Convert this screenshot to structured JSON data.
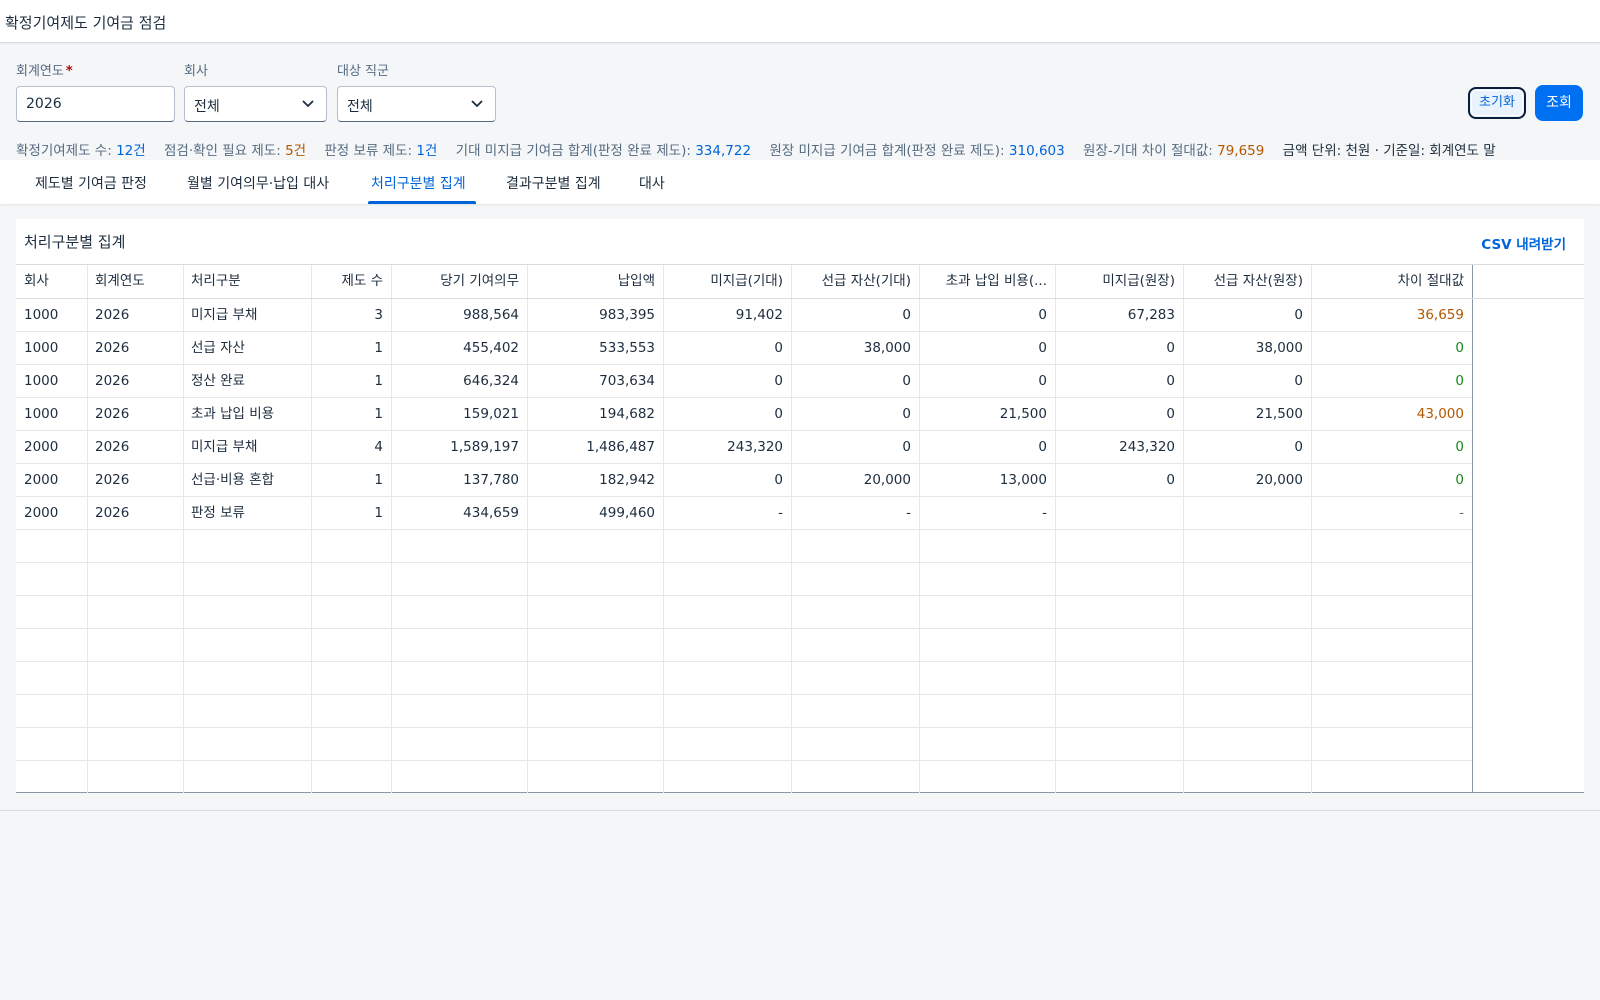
{
  "header": {
    "title": "확정기여제도 기여금 점검"
  },
  "filters": {
    "year": {
      "label": "회계연도",
      "required_mark": "*",
      "value": "2026"
    },
    "company": {
      "label": "회사",
      "value": "전체"
    },
    "group": {
      "label": "대상 직군",
      "value": "전체"
    }
  },
  "buttons": {
    "reset": "초기화",
    "search": "조회"
  },
  "kpis": [
    {
      "label": "확정기여제도 수:",
      "value": "12건",
      "tone": "info"
    },
    {
      "label": "점검·확인 필요 제도:",
      "value": "5건",
      "tone": "warn"
    },
    {
      "label": "판정 보류 제도:",
      "value": "1건",
      "tone": "info"
    },
    {
      "label": "기대 미지급 기여금 합계(판정 완료 제도):",
      "value": "334,722",
      "tone": "info"
    },
    {
      "label": "원장 미지급 기여금 합계(판정 완료 제도):",
      "value": "310,603",
      "tone": "info"
    },
    {
      "label": "원장-기대 차이 절대값:",
      "value": "79,659",
      "tone": "warn"
    }
  ],
  "unit_note": "금액 단위: 천원 · 기준일: 회계연도 말",
  "tabs": [
    {
      "label": "제도별 기여금 판정"
    },
    {
      "label": "월별 기여의무·납입 대사"
    },
    {
      "label": "처리구분별 집계",
      "active": true
    },
    {
      "label": "결과구분별 집계"
    },
    {
      "label": "대사"
    }
  ],
  "panel": {
    "title": "처리구분별 집계",
    "csv_label": "CSV 내려받기"
  },
  "table": {
    "columns": [
      "회사",
      "회계연도",
      "처리구분",
      "제도 수",
      "당기 기여의무",
      "납입액",
      "미지급(기대)",
      "선급 자산(기대)",
      "초과 납입 비용(...",
      "미지급(원장)",
      "선급 자산(원장)",
      "차이 절대값"
    ],
    "rows": [
      [
        "1000",
        "2026",
        "미지급 부채",
        "3",
        "988,564",
        "983,395",
        "91,402",
        "0",
        "0",
        "67,283",
        "0",
        "36,659"
      ],
      [
        "1000",
        "2026",
        "선급 자산",
        "1",
        "455,402",
        "533,553",
        "0",
        "38,000",
        "0",
        "0",
        "38,000",
        "0"
      ],
      [
        "1000",
        "2026",
        "정산 완료",
        "1",
        "646,324",
        "703,634",
        "0",
        "0",
        "0",
        "0",
        "0",
        "0"
      ],
      [
        "1000",
        "2026",
        "초과 납입 비용",
        "1",
        "159,021",
        "194,682",
        "0",
        "0",
        "21,500",
        "0",
        "21,500",
        "43,000"
      ],
      [
        "2000",
        "2026",
        "미지급 부채",
        "4",
        "1,589,197",
        "1,486,487",
        "243,320",
        "0",
        "0",
        "243,320",
        "0",
        "0"
      ],
      [
        "2000",
        "2026",
        "선급·비용 혼합",
        "1",
        "137,780",
        "182,942",
        "0",
        "20,000",
        "13,000",
        "0",
        "20,000",
        "0"
      ],
      [
        "2000",
        "2026",
        "판정 보류",
        "1",
        "434,659",
        "499,460",
        "-",
        "-",
        "-",
        "",
        "",
        "-"
      ]
    ]
  }
}
